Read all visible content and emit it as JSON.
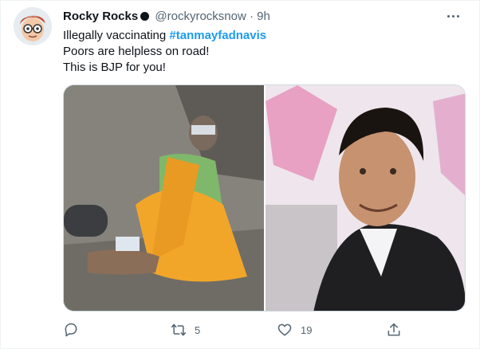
{
  "user": {
    "name": "Rocky Rocks",
    "handle": "@rockyrocksnow",
    "separator": "·",
    "time": "9h"
  },
  "tweet": {
    "line1_prefix": "Illegally vaccinating ",
    "hashtag": "#tanmayfadnavis",
    "line2": "Poors are helpless on road!",
    "line3": "This is BJP for you!"
  },
  "actions": {
    "reply_count": "",
    "retweet_count": "5",
    "like_count": "19"
  },
  "icons": {
    "verified": "verified-badge-icon",
    "more": "more-icon",
    "reply": "reply-icon",
    "retweet": "retweet-icon",
    "like": "heart-icon",
    "share": "share-icon"
  },
  "colors": {
    "link": "#1d9bf0",
    "muted": "#536471",
    "text": "#0f1419"
  }
}
